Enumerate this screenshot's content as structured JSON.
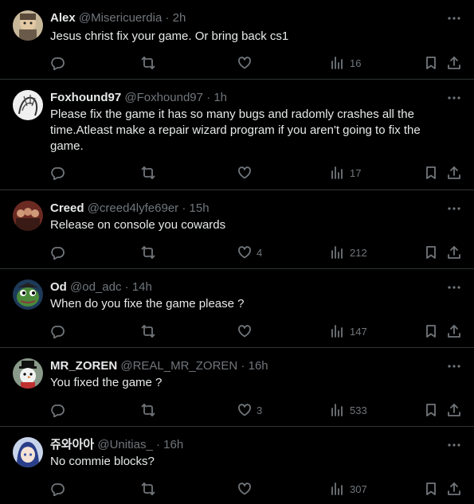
{
  "tweets": [
    {
      "name": "Alex",
      "handle": "@Misericuerdia",
      "dot": "·",
      "time": "2h",
      "text": "Jesus christ fix your game. Or bring back cs1",
      "likes": "",
      "views": "16",
      "avatar_color": "#7a6a55"
    },
    {
      "name": "Foxhound97",
      "handle": "@Foxhound97",
      "dot": "·",
      "time": "1h",
      "text": "Please fix the game it has so many bugs and radomly crashes all the time.Atleast make a repair wizard program if you aren't going to fix the game.",
      "likes": "",
      "views": "17",
      "avatar_color": "#d8d8d8"
    },
    {
      "name": "Creed",
      "handle": "@creed4lyfe69er",
      "dot": "·",
      "time": "15h",
      "text": "Release on console you cowards",
      "likes": "4",
      "views": "212",
      "avatar_color": "#8a3a2a"
    },
    {
      "name": "Od",
      "handle": "@od_adc",
      "dot": "·",
      "time": "14h",
      "text": "When do you fixe the game please ?",
      "likes": "",
      "views": "147",
      "avatar_color": "#3f7a3a"
    },
    {
      "name": "MR_ZOREN",
      "handle": "@REAL_MR_ZOREN",
      "dot": "·",
      "time": "16h",
      "text": "You fixed the game ?",
      "likes": "3",
      "views": "533",
      "avatar_color": "#6a7a6a"
    },
    {
      "name": "쥬와아아",
      "handle": "@Unitias_",
      "dot": "·",
      "time": "16h",
      "text": "No commie blocks?",
      "likes": "",
      "views": "307",
      "avatar_color": "#3a4f8a"
    }
  ],
  "colors": {
    "background": "#000000",
    "text": "#e7e9ea",
    "muted": "#71767b",
    "divider": "#2f3336"
  },
  "icons": [
    "reply-icon",
    "repost-icon",
    "like-icon",
    "views-icon",
    "bookmark-icon",
    "share-icon",
    "more-icon"
  ]
}
